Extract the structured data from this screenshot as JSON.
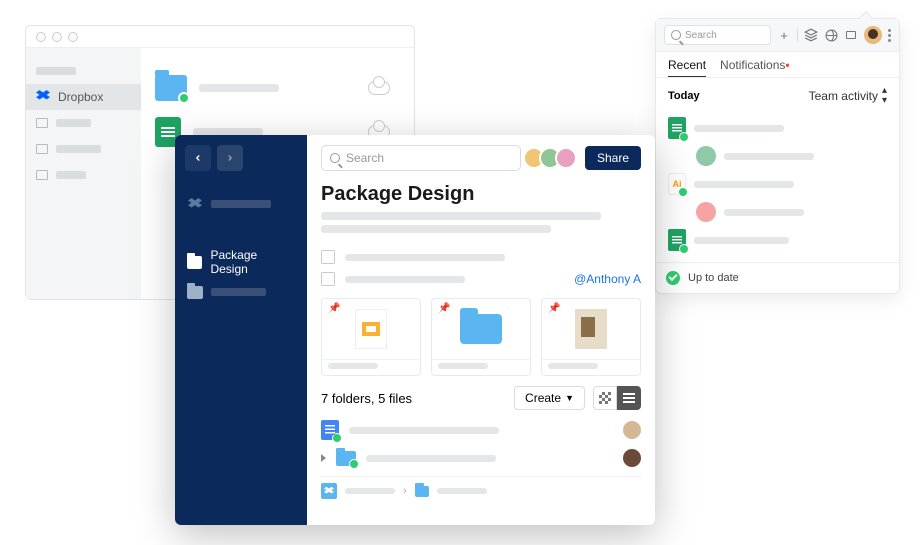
{
  "finder": {
    "sidebar": {
      "dropbox_label": "Dropbox"
    }
  },
  "main": {
    "search_placeholder": "Search",
    "share_label": "Share",
    "title": "Package Design",
    "mention": "@Anthony A",
    "count_summary": "7 folders, 5 files",
    "create_label": "Create",
    "sidebar_item_label": "Package Design"
  },
  "panel": {
    "search_placeholder": "Search",
    "tabs": {
      "recent": "Recent",
      "notifications": "Notifications"
    },
    "section_today": "Today",
    "section_team": "Team activity",
    "footer_status": "Up to date"
  }
}
